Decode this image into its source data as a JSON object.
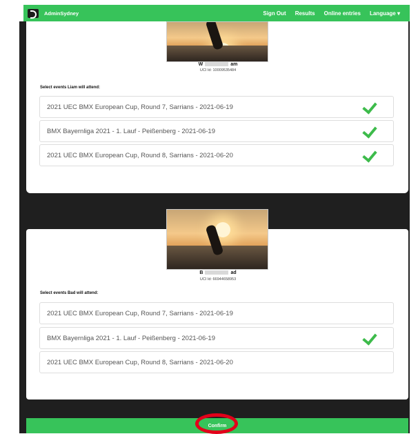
{
  "nav": {
    "brand": "AdminSydney",
    "links": [
      "Sign Out",
      "Results",
      "Online entries",
      "Language ▾"
    ]
  },
  "riders": [
    {
      "name_start": "W",
      "name_end": "am",
      "uci": "UCI Id: 10009535484",
      "select_label": "Select events Liam will attend:",
      "events": [
        {
          "label": "2021 UEC BMX European Cup, Round 7, Sarrians - 2021-06-19",
          "checked": true
        },
        {
          "label": "BMX Bayernliga 2021 - 1. Lauf - Peißenberg - 2021-06-19",
          "checked": true
        },
        {
          "label": "2021 UEC BMX European Cup, Round 8, Sarrians - 2021-06-20",
          "checked": true
        }
      ]
    },
    {
      "name_start": "B",
      "name_end": "ad",
      "uci": "UCI Id: 66944658953",
      "select_label": "Select events Bad will attend:",
      "events": [
        {
          "label": "2021 UEC BMX European Cup, Round 7, Sarrians - 2021-06-19",
          "checked": false
        },
        {
          "label": "BMX Bayernliga 2021 - 1. Lauf - Peißenberg - 2021-06-19",
          "checked": true
        },
        {
          "label": "2021 UEC BMX European Cup, Round 8, Sarrians - 2021-06-20",
          "checked": false
        }
      ]
    }
  ],
  "confirm_label": "Confirm",
  "colors": {
    "accent": "#37c35a",
    "check": "#3dbb4b",
    "annotation": "#e2001a",
    "dark_bg": "#1f1f1f"
  }
}
